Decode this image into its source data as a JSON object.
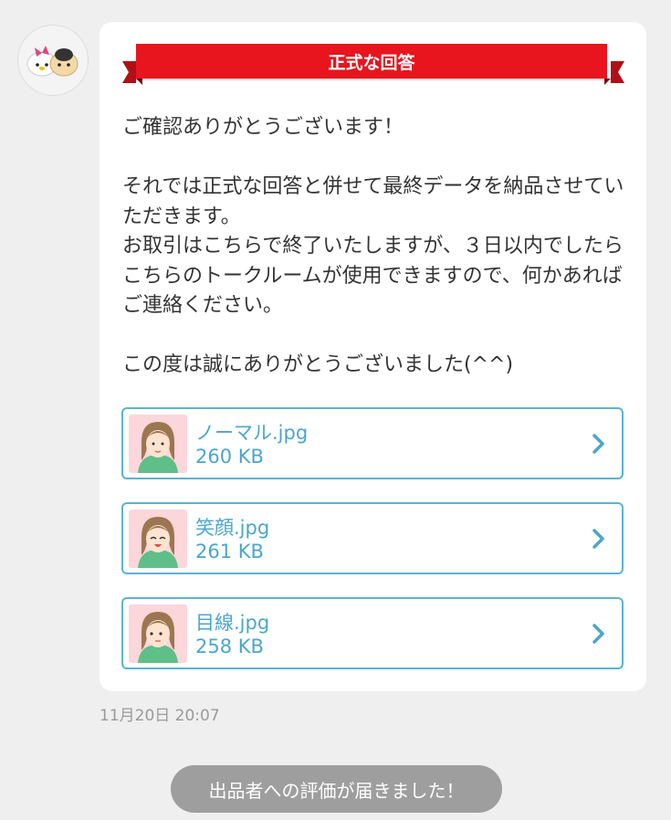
{
  "message": {
    "banner_label": "正式な回答",
    "body": "ご確認ありがとうございます！\n\nそれでは正式な回答と併せて最終データを納品させていただきます。\nお取引はこちらで終了いたしますが、３日以内でしたらこちらのトークルームが使用できますので、何かあればご連絡ください。\n\nこの度は誠にありがとうございました(^^)",
    "timestamp": "11月20日 20:07"
  },
  "attachments": [
    {
      "name": "ノーマル.jpg",
      "size": "260 KB",
      "icon": "chevron-right-icon"
    },
    {
      "name": "笑顔.jpg",
      "size": "261 KB",
      "icon": "chevron-right-icon"
    },
    {
      "name": "目線.jpg",
      "size": "258 KB",
      "icon": "chevron-right-icon"
    }
  ],
  "system_notice": "出品者への評価が届きました！",
  "colors": {
    "banner": "#e8141e",
    "link": "#4ba6cd",
    "card_border": "#5ab3d6",
    "notice_bg": "#9e9e9e"
  }
}
